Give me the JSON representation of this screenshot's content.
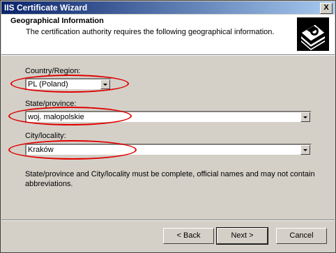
{
  "window": {
    "title": "IIS Certificate Wizard",
    "close_label": "X"
  },
  "header": {
    "title": "Geographical Information",
    "subtitle": "The certification authority requires the following geographical information.",
    "icon": "certificate-wizard-icon"
  },
  "fields": {
    "country": {
      "label": "Country/Region:",
      "value": "PL (Poland)"
    },
    "state": {
      "label": "State/province:",
      "value": "woj. małopolskie"
    },
    "city": {
      "label": "City/locality:",
      "value": "Kraków"
    }
  },
  "note": "State/province and City/locality must be complete, official names and may not contain abbreviations.",
  "buttons": {
    "back": "< Back",
    "next": "Next >",
    "cancel": "Cancel"
  },
  "annotation_color": "#e00000"
}
